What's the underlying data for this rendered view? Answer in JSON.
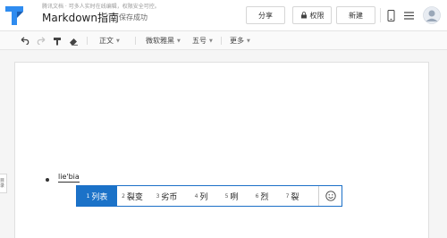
{
  "header": {
    "subtitle": "腾讯文档 · 可多人实时在线编辑，权限安全可控。",
    "title": "Markdown指南",
    "save_status": "保存成功",
    "share_label": "分享",
    "permission_label": "权限",
    "new_label": "新建"
  },
  "toolbar": {
    "style_label": "正文",
    "font_label": "微软雅黑",
    "size_label": "五号",
    "more_label": "更多"
  },
  "sidebar": {
    "tab_label": "目录"
  },
  "editor": {
    "typed_text": "lie'bia"
  },
  "ime": {
    "candidates": [
      {
        "num": "1",
        "text": "列表"
      },
      {
        "num": "2",
        "text": "裂变"
      },
      {
        "num": "3",
        "text": "劣币"
      },
      {
        "num": "4",
        "text": "列"
      },
      {
        "num": "5",
        "text": "咧"
      },
      {
        "num": "6",
        "text": "烈"
      },
      {
        "num": "7",
        "text": "裂"
      }
    ]
  },
  "colors": {
    "brand_blue": "#1b72c8",
    "logo_blue": "#2f8cf0"
  }
}
